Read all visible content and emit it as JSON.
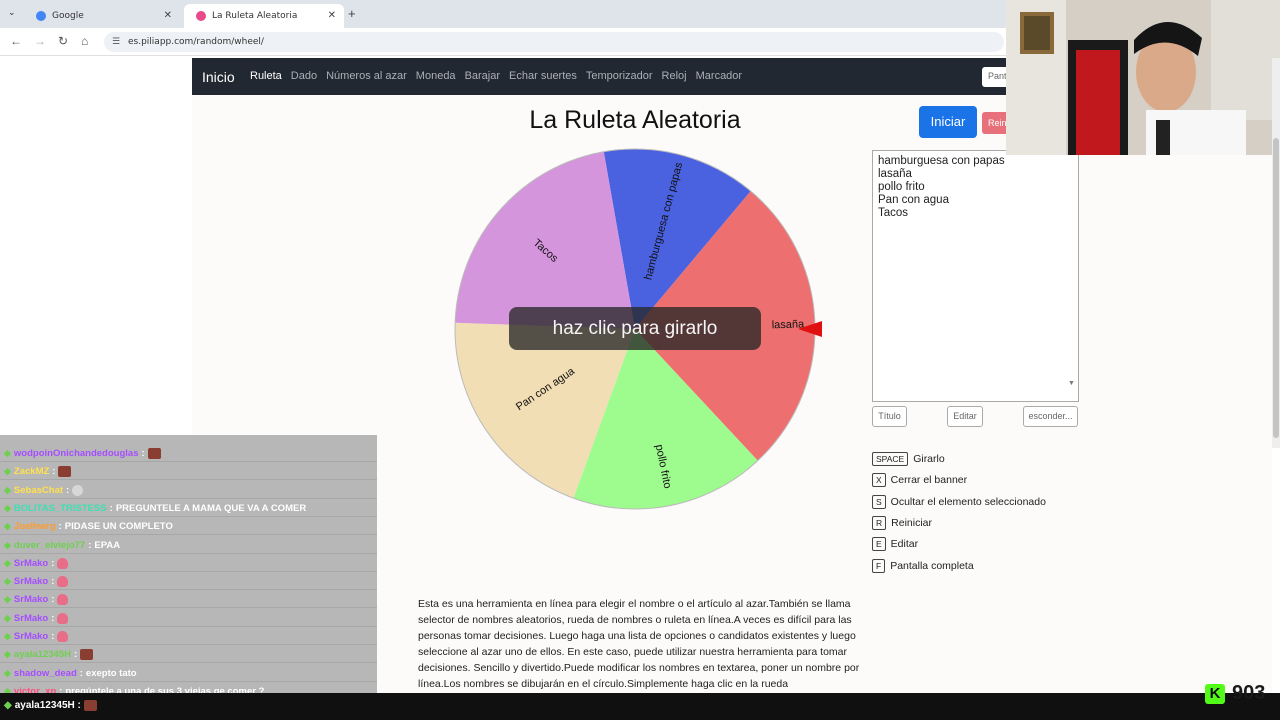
{
  "browser": {
    "tabs": [
      {
        "title": "Google",
        "favicon_color": "#4285f4"
      },
      {
        "title": "La Ruleta Aleatoria",
        "favicon_color": "#e94b8a"
      }
    ],
    "url": "es.piliapp.com/random/wheel/"
  },
  "site_nav": {
    "brand": "Inicio",
    "links": [
      "Ruleta",
      "Dado",
      "Números al azar",
      "Moneda",
      "Barajar",
      "Echar suertes",
      "Temporizador",
      "Reloj",
      "Marcador"
    ],
    "search_placeholder": "Panta"
  },
  "page": {
    "title": "La Ruleta Aleatoria",
    "start_button": "Iniciar",
    "reset_button": "Reiniciar",
    "spin_overlay": "haz clic para girarlo"
  },
  "wheel": {
    "segments": [
      {
        "label": "hamburguesa con papas",
        "color": "#4a62e0"
      },
      {
        "label": "lasaña",
        "color": "#ee6f6f"
      },
      {
        "label": "pollo frito",
        "color": "#9efb8e"
      },
      {
        "label": "Pan con agua",
        "color": "#f2deb4"
      },
      {
        "label": "Tacos",
        "color": "#d595dd"
      }
    ]
  },
  "editor": {
    "lines": [
      "hamburguesa con papas",
      "lasaña",
      "pollo frito",
      "Pan con agua",
      "Tacos"
    ],
    "buttons": [
      "Título",
      "Editar",
      "esconder..."
    ]
  },
  "shortcuts": [
    {
      "key": "SPACE",
      "label": "Girarlo"
    },
    {
      "key": "X",
      "label": "Cerrar el banner"
    },
    {
      "key": "S",
      "label": "Ocultar el elemento seleccionado"
    },
    {
      "key": "R",
      "label": "Reiniciar"
    },
    {
      "key": "E",
      "label": "Editar"
    },
    {
      "key": "F",
      "label": "Pantalla completa"
    }
  ],
  "description": "Esta es una herramienta en línea para elegir el nombre o el artículo al azar.También se llama selector de nombres aleatorios, rueda de nombres o ruleta en línea.A veces es difícil para las personas tomar decisiones. Luego haga una lista de opciones o candidatos existentes y luego seleccione al azar uno de ellos. En este caso, puede utilizar nuestra herramienta para tomar decisiones. Sencillo y divertido.Puede modificar los nombres en textarea, poner un nombre por línea.Los nombres se dibujarán en el círculo.Simplemente haga clic en la rueda",
  "chat": [
    {
      "user": "wodpoinOnichandedouglas",
      "msg": "",
      "emote": "face",
      "user_color": "#a64dff"
    },
    {
      "user": "ZackMZ",
      "msg": "",
      "emote": "face",
      "user_color": "#ffe14d"
    },
    {
      "user": "SebasChat",
      "msg": "",
      "emote": "skull",
      "user_color": "#ffe14d"
    },
    {
      "user": "BOLITAS_TRISTESS",
      "msg": "PREGUNTELE A MAMA QUE VA A COMER",
      "emote": "",
      "user_color": "#3de0b0"
    },
    {
      "user": "Joelhwrg",
      "msg": "PIDASE UN COMPLETO",
      "emote": "",
      "user_color": "#ff9c2e"
    },
    {
      "user": "duver_elviejo77",
      "msg": "EPAA",
      "emote": "",
      "user_color": "#6ed04f"
    },
    {
      "user": "SrMako",
      "msg": "",
      "emote": "heart",
      "user_color": "#a64dff"
    },
    {
      "user": "SrMako",
      "msg": "",
      "emote": "heart",
      "user_color": "#a64dff"
    },
    {
      "user": "SrMako",
      "msg": "",
      "emote": "heart",
      "user_color": "#a64dff"
    },
    {
      "user": "SrMako",
      "msg": "",
      "emote": "heart",
      "user_color": "#a64dff"
    },
    {
      "user": "SrMako",
      "msg": "",
      "emote": "heart",
      "user_color": "#a64dff"
    },
    {
      "user": "ayala12345H",
      "msg": "",
      "emote": "face",
      "user_color": "#6ed04f"
    },
    {
      "user": "shadow_dead",
      "msg": "exepto tato",
      "emote": "",
      "user_color": "#a64dff"
    },
    {
      "user": "victor_xp",
      "msg": "pregúntele a una de sus 3 viejas qe comer ?",
      "emote": "",
      "user_color": "#ff4d7a"
    }
  ],
  "bottom_chat": {
    "user": "ayala12345H",
    "emote": "face"
  },
  "viewer_count": "903"
}
